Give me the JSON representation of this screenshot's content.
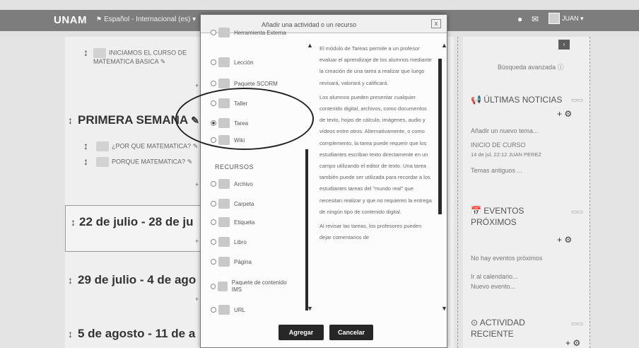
{
  "navbar": {
    "brand": "UNAM",
    "language": "Español - Internacional (es) ▾",
    "user": "JUAN ▾"
  },
  "course": {
    "intro_item": "INICIAMOS EL CURSO DE MATEMATICA BASICA",
    "week1_title": "PRIMERA SEMANA",
    "week1_items": [
      "¿POR QUE MATEMATICA?",
      "PORQUE MATEMATICA?"
    ],
    "add_link": "+ A",
    "section2_title": "22 de julio - 28 de ju",
    "section3_title": "29 de julio - 4 de ago",
    "section4_title": "5 de agosto - 11 de a"
  },
  "sidebar": {
    "advanced_search": "Búsqueda avanzada ⓘ",
    "news_title": "ÚLTIMAS NOTICIAS",
    "news_add": "Añadir un nuevo tema...",
    "news_post_title": "INICIO DE CURSO",
    "news_post_meta": "14 de jul, 22:12 JUAN PEREZ",
    "news_older": "Temas antiguos ...",
    "events_title": "EVENTOS PRÓXIMOS",
    "events_none": "No hay eventos próximos",
    "events_calendar": "Ir al calendario...",
    "events_new": "Nuevo evento...",
    "activity_title": "ACTIVIDAD RECIENTE"
  },
  "modal": {
    "title": "Añadir una actividad o un recurso",
    "close": "x",
    "activities": [
      {
        "label": "Herramienta Externa",
        "selected": false
      },
      {
        "label": "Lección",
        "selected": false
      },
      {
        "label": "Paquete SCORM",
        "selected": false
      },
      {
        "label": "Taller",
        "selected": false
      },
      {
        "label": "Tarea",
        "selected": true
      },
      {
        "label": "Wiki",
        "selected": false
      }
    ],
    "resources_heading": "RECURSOS",
    "resources": [
      {
        "label": "Archivo"
      },
      {
        "label": "Carpeta"
      },
      {
        "label": "Etiqueta"
      },
      {
        "label": "Libro"
      },
      {
        "label": "Página"
      },
      {
        "label": "Paquete de contenido IMS"
      },
      {
        "label": "URL"
      }
    ],
    "description": [
      "El módulo de Tareas permite a un profesor evaluar el aprendizaje de los alumnos mediante la creación de una tarea a realizar que luego revisará, valorará y calificará.",
      "Los alumnos pueden presentar cualquier contenido digital, archivos, como documentos de texto, hojas de cálculo, imágenes, audio y vídeos entre otros. Alternativamente, o como complemento, la tarea puede requerir que los estudiantes escriban texto directamente en un campo utilizando el editor de texto. Una tarea también puede ser utilizada para recordar a los estudiantes tareas del \"mundo real\" que necesitan realizar y que no requieren la entrega de ningún tipo de contenido digital.",
      "Al revisar las tareas, los profesores pueden dejar comentarios de"
    ],
    "add_button": "Agregar",
    "cancel_button": "Cancelar"
  }
}
